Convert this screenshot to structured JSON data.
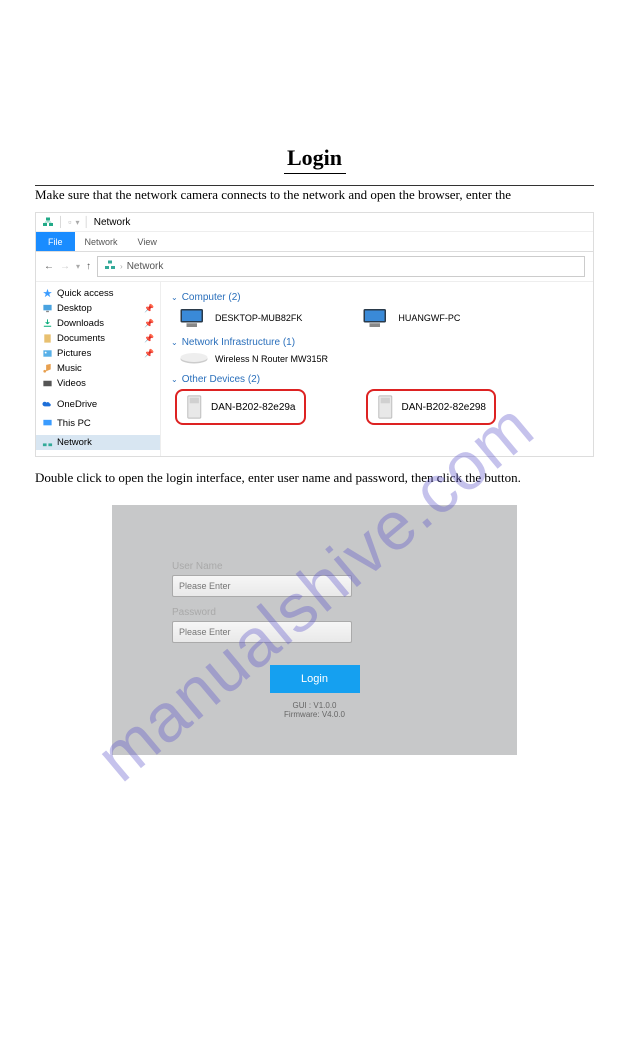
{
  "doc": {
    "title": "Login",
    "intro1": "Make sure that the network camera connects to the network and open the browser, enter the",
    "intro2": "Double click to open the login interface, enter user name and password, then click the button."
  },
  "explorer": {
    "location": "Network",
    "tabs": {
      "file": "File",
      "network": "Network",
      "view": "View"
    },
    "breadcrumb": "Network",
    "sidebar": {
      "quick_access": "Quick access",
      "desktop": "Desktop",
      "downloads": "Downloads",
      "documents": "Documents",
      "pictures": "Pictures",
      "music": "Music",
      "videos": "Videos",
      "onedrive": "OneDrive",
      "this_pc": "This PC",
      "network": "Network"
    },
    "groups": {
      "computer": "Computer (2)",
      "computer_items": [
        "DESKTOP-MUB82FK",
        "HUANGWF-PC"
      ],
      "infra": "Network Infrastructure (1)",
      "infra_items": [
        "Wireless N Router MW315R"
      ],
      "other": "Other Devices (2)",
      "other_items": [
        "DAN-B202-82e29a",
        "DAN-B202-82e298"
      ]
    }
  },
  "login": {
    "user_label": "User Name",
    "user_placeholder": "Please Enter",
    "pass_label": "Password",
    "pass_placeholder": "Please Enter",
    "button": "Login",
    "gui_version": "GUI : V1.0.0",
    "fw_version": "Firmware: V4.0.0"
  },
  "watermark": "manualshive.com"
}
